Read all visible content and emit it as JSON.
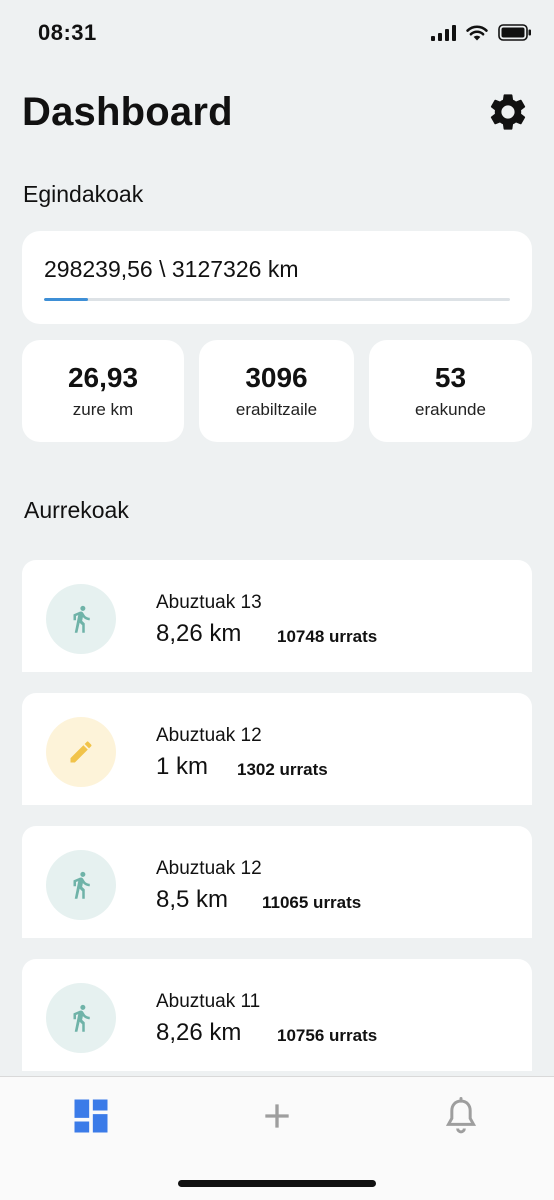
{
  "status_bar": {
    "time": "08:31",
    "icons": [
      "signal-icon",
      "wifi-icon",
      "battery-icon"
    ]
  },
  "header": {
    "title": "Dashboard",
    "settings_icon": "gear-icon"
  },
  "done_section": {
    "title": "Egindakoak",
    "progress_text": "298239,56 \\ 3127326 km",
    "progress_value": 298239.56,
    "progress_total": 3127326,
    "stats": [
      {
        "value": "26,93",
        "label": "zure km"
      },
      {
        "value": "3096",
        "label": "erabiltzaile"
      },
      {
        "value": "53",
        "label": "erakunde"
      }
    ]
  },
  "previous_section": {
    "title": "Aurrekoak",
    "items": [
      {
        "type": "walk",
        "icon": "walking-person-icon",
        "date": "Abuztuak 13",
        "km": "8,26 km",
        "steps": "10748 urrats"
      },
      {
        "type": "manual",
        "icon": "pencil-icon",
        "date": "Abuztuak 12",
        "km": "1 km",
        "steps": "1302 urrats"
      },
      {
        "type": "walk",
        "icon": "walking-person-icon",
        "date": "Abuztuak 12",
        "km": "8,5 km",
        "steps": "11065 urrats"
      },
      {
        "type": "walk",
        "icon": "walking-person-icon",
        "date": "Abuztuak 11",
        "km": "8,26 km",
        "steps": "10756 urrats"
      }
    ]
  },
  "bottom_nav": {
    "items": [
      {
        "name": "dashboard",
        "icon": "dashboard-icon",
        "active": true
      },
      {
        "name": "add",
        "icon": "plus-icon",
        "active": false
      },
      {
        "name": "notifications",
        "icon": "bell-icon",
        "active": false
      }
    ]
  },
  "colors": {
    "background": "#eef1f2",
    "accent": "#3e8fd6",
    "nav_active": "#3b7be8",
    "nav_inactive": "#9e9e9e",
    "walk_icon": "#6fb3a8",
    "walk_icon_bg": "#e6f1f0",
    "manual_icon": "#f1c34a",
    "manual_icon_bg": "#fdf3d9"
  }
}
